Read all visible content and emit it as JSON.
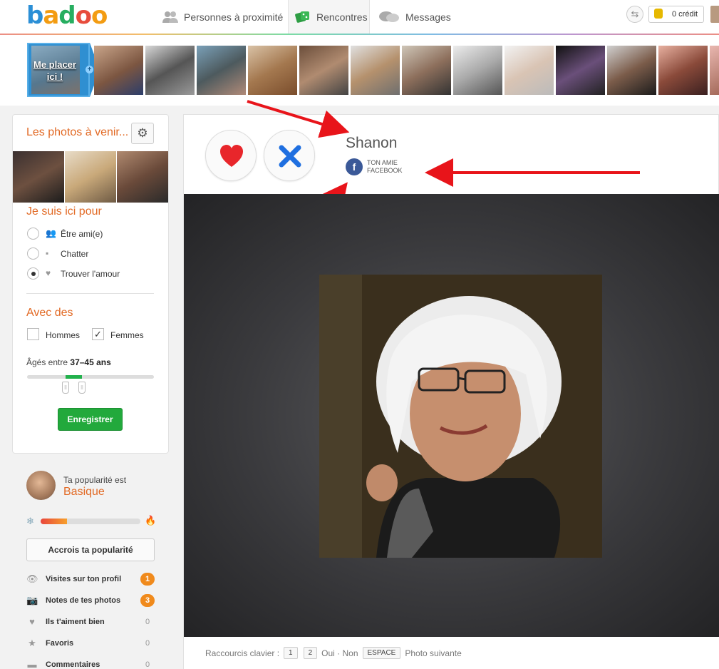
{
  "brand": {
    "logo_text": "badoo",
    "colors": [
      "#e74c3c",
      "#f39c12",
      "#2ecc71",
      "#3498db",
      "#9b59b6"
    ]
  },
  "nav": {
    "items": [
      {
        "label": "Personnes à proximité",
        "icon": "people-icon"
      },
      {
        "label": "Rencontres",
        "icon": "dice-icon",
        "active": true
      },
      {
        "label": "Messages",
        "icon": "chat-bubbles-icon"
      }
    ],
    "credit_label": "0 crédit"
  },
  "strip": {
    "place_me_label": "Me placer ici !"
  },
  "sidebar": {
    "future_photos_title": "Les photos à venir...",
    "here_for_title": "Je suis ici pour",
    "here_for_options": [
      {
        "label": "Être ami(e)",
        "icon": "people-icon",
        "selected": false
      },
      {
        "label": "Chatter",
        "icon": "speech-icon",
        "selected": false
      },
      {
        "label": "Trouver l'amour",
        "icon": "heart-icon",
        "selected": true
      }
    ],
    "with_title": "Avec des",
    "gender_options": [
      {
        "label": "Hommes",
        "checked": false
      },
      {
        "label": "Femmes",
        "checked": true
      }
    ],
    "age_prefix": "Âgés entre",
    "age_range": "37–45 ans",
    "age_min": 37,
    "age_max": 45,
    "save_label": "Enregistrer",
    "popularity_label": "Ta popularité est",
    "popularity_value": "Basique",
    "popularity_level": 0.26,
    "boost_label": "Accrois ta popularité",
    "stats": [
      {
        "label": "Visites sur ton profil",
        "icon": "eye-icon",
        "count": "1"
      },
      {
        "label": "Notes de tes photos",
        "icon": "camera-icon",
        "count": "3"
      },
      {
        "label": "Ils t'aiment bien",
        "icon": "heart-icon",
        "count": "0"
      },
      {
        "label": "Favoris",
        "icon": "star-icon",
        "count": "0"
      },
      {
        "label": "Commentaires",
        "icon": "comment-icon",
        "count": "0"
      }
    ]
  },
  "profile": {
    "name": "Shanon",
    "facebook_line1": "TON AMIE",
    "facebook_line2": "FACEBOOK"
  },
  "footer": {
    "shortcuts_label": "Raccourcis clavier :",
    "key1": "1",
    "key2": "2",
    "yes_no": "Oui · Non",
    "space_key": "ESPACE",
    "next_photo": "Photo suivante"
  }
}
